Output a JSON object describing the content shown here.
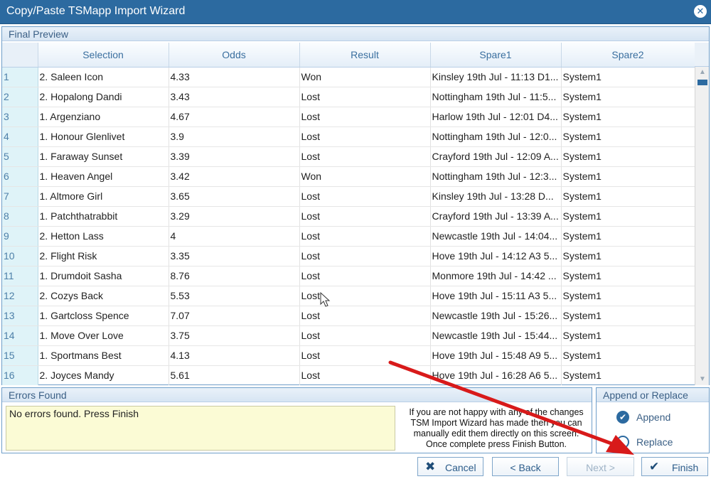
{
  "window": {
    "title": "Copy/Paste TSMapp Import Wizard",
    "close_icon": "close-circle-icon"
  },
  "preview": {
    "heading": "Final Preview",
    "columns": [
      "",
      "Selection",
      "Odds",
      "Result",
      "Spare1",
      "Spare2"
    ],
    "rows": [
      [
        "1",
        "2. Saleen Icon",
        "4.33",
        "Won",
        "Kinsley 19th Jul - 11:13 D1...",
        "System1"
      ],
      [
        "2",
        "2. Hopalong Dandi",
        "3.43",
        "Lost",
        "Nottingham 19th Jul - 11:5...",
        "System1"
      ],
      [
        "3",
        "1. Argenziano",
        "4.67",
        "Lost",
        "Harlow 19th Jul - 12:01 D4...",
        "System1"
      ],
      [
        "4",
        "1. Honour Glenlivet",
        "3.9",
        "Lost",
        "Nottingham 19th Jul - 12:0...",
        "System1"
      ],
      [
        "5",
        "1. Faraway Sunset",
        "3.39",
        "Lost",
        "Crayford 19th Jul - 12:09 A...",
        "System1"
      ],
      [
        "6",
        "1. Heaven Angel",
        "3.42",
        "Won",
        "Nottingham 19th Jul - 12:3...",
        "System1"
      ],
      [
        "7",
        "1. Altmore Girl",
        "3.65",
        "Lost",
        "Kinsley 19th Jul - 13:28 D...",
        "System1"
      ],
      [
        "8",
        "1. Patchthatrabbit",
        "3.29",
        "Lost",
        "Crayford 19th Jul - 13:39 A...",
        "System1"
      ],
      [
        "9",
        "2. Hetton Lass",
        "4",
        "Lost",
        "Newcastle 19th Jul - 14:04...",
        "System1"
      ],
      [
        "10",
        "2. Flight Risk",
        "3.35",
        "Lost",
        "Hove 19th Jul - 14:12 A3 5...",
        "System1"
      ],
      [
        "11",
        "1. Drumdoit Sasha",
        "8.76",
        "Lost",
        "Monmore 19th Jul - 14:42 ...",
        "System1"
      ],
      [
        "12",
        "2. Cozys Back",
        "5.53",
        "Lost",
        "Hove 19th Jul - 15:11 A3 5...",
        "System1"
      ],
      [
        "13",
        "1. Gartcloss Spence",
        "7.07",
        "Lost",
        "Newcastle 19th Jul - 15:26...",
        "System1"
      ],
      [
        "14",
        "1. Move Over Love",
        "3.75",
        "Lost",
        "Newcastle 19th Jul - 15:44...",
        "System1"
      ],
      [
        "15",
        "1. Sportmans Best",
        "4.13",
        "Lost",
        "Hove 19th Jul - 15:48 A9 5...",
        "System1"
      ],
      [
        "16",
        "2. Joyces Mandy",
        "5.61",
        "Lost",
        "Hove 19th Jul - 16:28 A6 5...",
        "System1"
      ]
    ]
  },
  "errors": {
    "heading": "Errors Found",
    "message": "No errors found. Press Finish",
    "note": "If you are not happy with any of the changes TSM Import Wizard has made then you can manually edit them directly on this screen. Once complete press Finish Button."
  },
  "append_replace": {
    "heading": "Append or Replace",
    "options": [
      {
        "label": "Append",
        "selected": true
      },
      {
        "label": "Replace",
        "selected": false
      }
    ]
  },
  "buttons": {
    "cancel": "Cancel",
    "back": "< Back",
    "next": "Next >",
    "finish": "Finish"
  },
  "colors": {
    "accent": "#2c6aa0",
    "annotation_arrow": "#d81a1a",
    "row_number_bg": "#dff3f8",
    "error_box_bg": "#fbfbd5"
  }
}
